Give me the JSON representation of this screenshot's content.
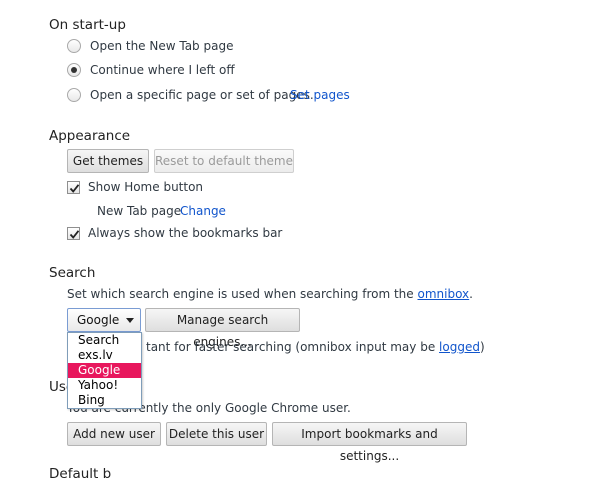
{
  "startup": {
    "heading": "On start-up",
    "options": [
      {
        "label": "Open the New Tab page",
        "checked": false
      },
      {
        "label": "Continue where I left off",
        "checked": true
      },
      {
        "label": "Open a specific page or set of pages.",
        "checked": false
      }
    ],
    "set_pages_link": "Set pages"
  },
  "appearance": {
    "heading": "Appearance",
    "get_themes": "Get themes",
    "reset_theme": "Reset to default theme",
    "show_home_label": "Show Home button",
    "show_home_checked": true,
    "home_page_label": "New Tab page",
    "change_link": "Change",
    "bookmarks_bar_label": "Always show the bookmarks bar",
    "bookmarks_bar_checked": true
  },
  "search": {
    "heading": "Search",
    "description": "Set which search engine is used when searching from the",
    "omnibox_link": "omnibox",
    "description_end": ".",
    "selected_engine": "Google",
    "manage_button": "Manage search engines...",
    "instant_text": "tant for faster searching (omnibox input may be",
    "logged_link": "logged",
    "instant_end": ")",
    "dropdown": {
      "items": [
        "Search",
        "exs.lv",
        "Google",
        "Yahoo!",
        "Bing"
      ],
      "highlight_color": "#e8175d"
    }
  },
  "users": {
    "heading_partial": "Use",
    "description_partial": "You are currently the only Google Chrome user.",
    "add_user": "Add new user",
    "delete_user": "Delete this user",
    "import_bookmarks": "Import bookmarks and settings..."
  },
  "default_browser": {
    "heading_partial": "Default b"
  }
}
